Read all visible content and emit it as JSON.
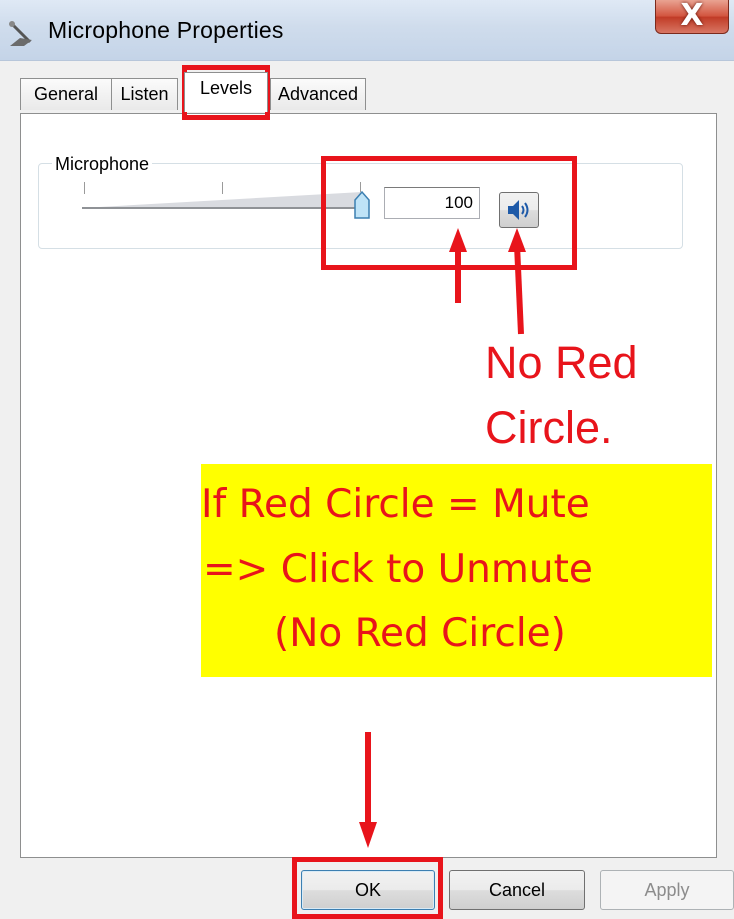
{
  "window": {
    "title": "Microphone Properties",
    "close_label": "X"
  },
  "tabs": [
    {
      "label": "General"
    },
    {
      "label": "Listen"
    },
    {
      "label": "Levels",
      "active": true
    },
    {
      "label": "Advanced"
    }
  ],
  "levels": {
    "group_label": "Microphone",
    "volume_value": "100",
    "volume_level_percent": 100,
    "muted": false
  },
  "annotations": {
    "no_red_circle_line1": "No Red",
    "no_red_circle_line2": "Circle.",
    "note_line1": "If Red Circle = Mute",
    "note_line2": "=> Click to Unmute",
    "note_line3": "(No Red Circle)",
    "highlight_color": "#e8141b",
    "note_background": "#ffff00"
  },
  "buttons": {
    "ok_label": "OK",
    "cancel_label": "Cancel",
    "apply_label": "Apply"
  }
}
